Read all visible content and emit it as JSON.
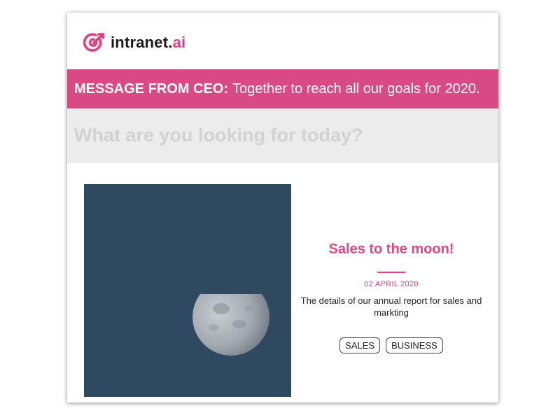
{
  "header": {
    "logo_icon": "target-arrow-icon",
    "logo_name": "intranet.",
    "logo_tld": "ai"
  },
  "ceo_message": {
    "label": "MESSAGE FROM CEO:",
    "text": "Together to reach all our goals for 2020."
  },
  "search": {
    "placeholder": "What are you looking for today?",
    "value": ""
  },
  "article": {
    "image": "moon-photo",
    "title": "Sales to the moon!",
    "date": "02 APRIL 2020",
    "summary": "The details of our annual report for sales and markting",
    "tags": [
      "SALES",
      "BUSINESS"
    ]
  },
  "colors": {
    "accent": "#d94a84",
    "search_bg": "#ececec",
    "image_bg": "#2f4a60"
  }
}
